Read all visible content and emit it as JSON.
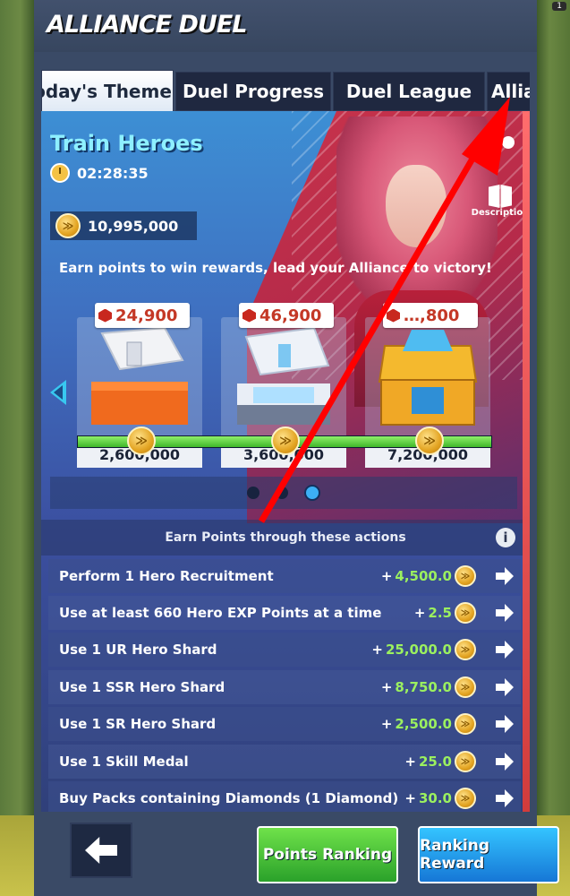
{
  "header": {
    "title": "ALLIANCE DUEL"
  },
  "top_right_badge": "1",
  "tabs": [
    {
      "label": "Today's Theme"
    },
    {
      "label": "Duel Progress"
    },
    {
      "label": "Duel League"
    },
    {
      "label": "Allia"
    }
  ],
  "theme": {
    "title": "Train Heroes",
    "timer": "02:28:35",
    "points": "10,995,000",
    "description_label": "Description",
    "slogan": "Earn points to win rewards, lead your Alliance to victory!"
  },
  "rewards": [
    {
      "cost": "24,900",
      "points": "2,600,000",
      "chest": "white-orange-chest"
    },
    {
      "cost": "46,900",
      "points": "3,600,000",
      "chest": "white-blue-chest"
    },
    {
      "cost": "…,800",
      "points": "7,200,000",
      "chest": "gold-chest"
    }
  ],
  "reward_progress": 1.0,
  "pagination": {
    "count": 3,
    "active": 2
  },
  "actions_header": "Earn Points through these actions",
  "actions": [
    {
      "label": "Perform 1 Hero Recruitment",
      "points": "4,500.0"
    },
    {
      "label": "Use at least 660 Hero EXP Points at a time",
      "points": "2.5"
    },
    {
      "label": "Use 1 UR Hero Shard",
      "points": "25,000.0"
    },
    {
      "label": "Use 1 SSR Hero Shard",
      "points": "8,750.0"
    },
    {
      "label": "Use 1 SR Hero Shard",
      "points": "2,500.0"
    },
    {
      "label": "Use 1 Skill Medal",
      "points": "25.0"
    },
    {
      "label": "Buy Packs containing Diamonds (1 Diamond)",
      "points": "30.0"
    }
  ],
  "buttons": {
    "points_ranking": "Points Ranking",
    "ranking_reward": "Ranking Reward"
  },
  "colors": {
    "accent_green": "#9bf05f",
    "theme_title": "#8ef0ff",
    "cost_red": "#c43826",
    "annotation_arrow": "#ff0000"
  }
}
